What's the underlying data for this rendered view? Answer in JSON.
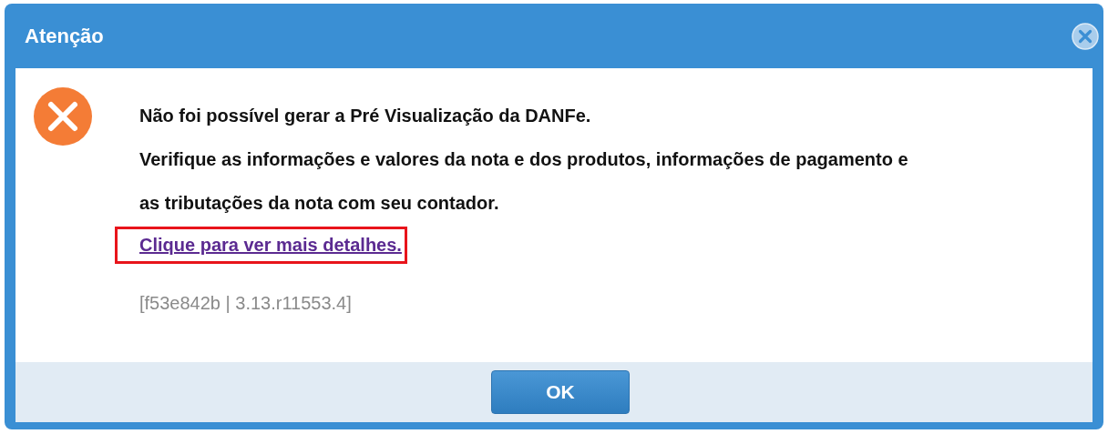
{
  "dialog": {
    "title": "Atenção",
    "messages": [
      "Não foi possível gerar a Pré Visualização da DANFe.",
      "Verifique as informações e valores da nota e dos produtos, informações de pagamento e as tributações da nota com seu contador."
    ],
    "link": {
      "label": "Clique para ver mais detalhes.",
      "highlighted": true
    },
    "version": "[f53e842b | 3.13.r11553.4]",
    "buttons": [
      "OK"
    ]
  }
}
